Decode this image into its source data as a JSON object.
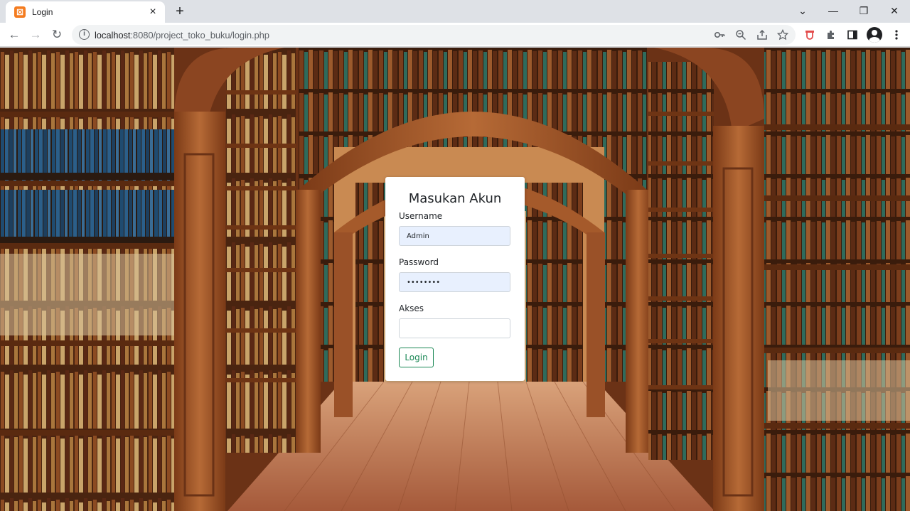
{
  "browser": {
    "tab": {
      "title": "Login",
      "favicon": "xampp-icon",
      "close": "×"
    },
    "new_tab": "+",
    "window_controls": {
      "tab_search": "⌄",
      "minimize": "—",
      "restore": "❐",
      "close": "✕"
    },
    "nav": {
      "back": "←",
      "forward": "→",
      "reload": "↻"
    },
    "address": {
      "host": "localhost",
      "rest": ":8080/project_toko_buku/login.php"
    },
    "omnibox_icons": [
      "key-icon",
      "zoom-icon",
      "share-icon",
      "bookmark-star-icon"
    ],
    "toolbar_icons": [
      "extension-shield-icon",
      "puzzle-icon",
      "side-panel-icon",
      "profile-icon",
      "menu-icon"
    ]
  },
  "login": {
    "title": "Masukan Akun",
    "username_label": "Username",
    "username_value": "Admin",
    "password_label": "Password",
    "password_value": "••••••••",
    "akses_label": "Akses",
    "akses_value": "",
    "button_label": "Login"
  },
  "colors": {
    "button_accent": "#198754",
    "autofill": "#e8f0fe"
  }
}
